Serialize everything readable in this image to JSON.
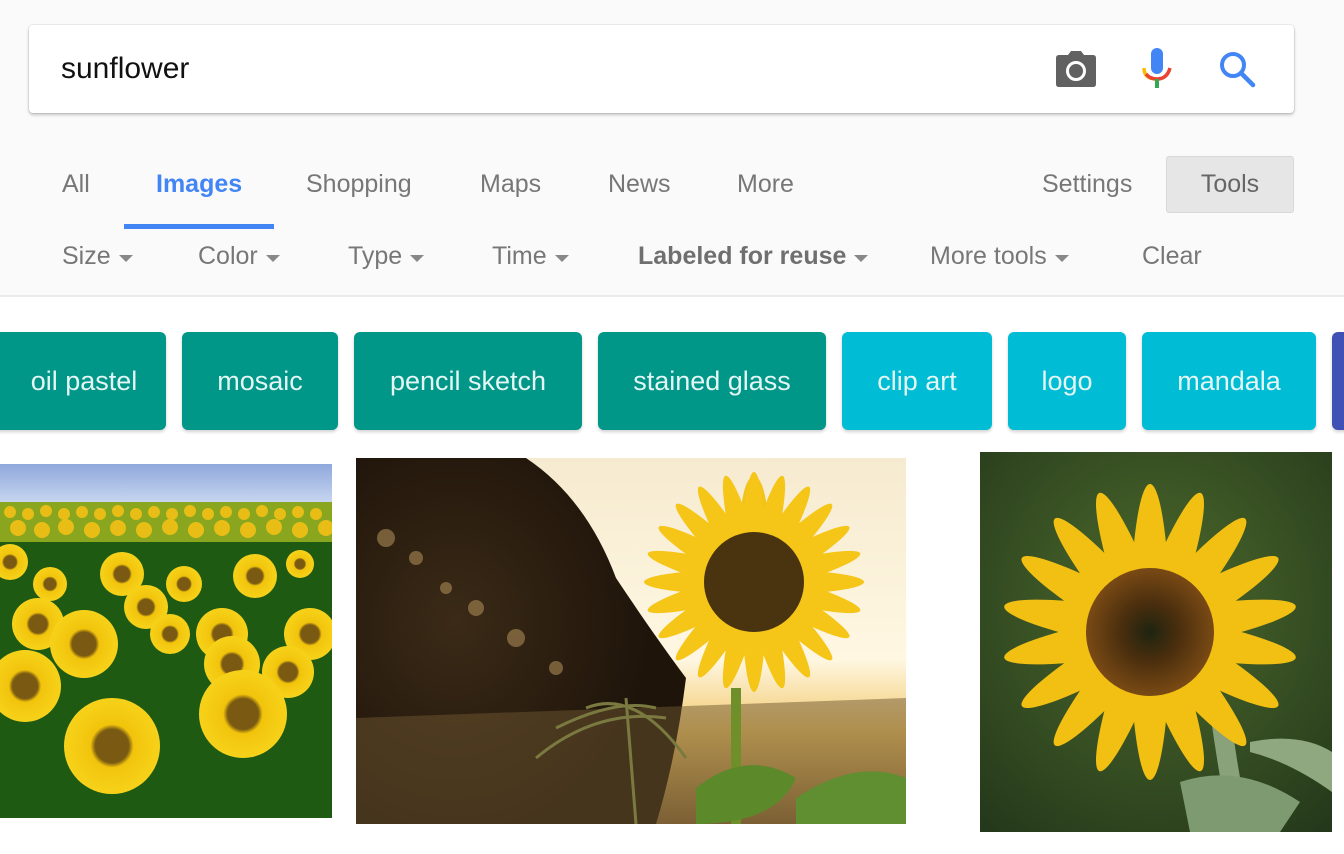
{
  "search": {
    "query": "sunflower",
    "icons": [
      "camera-icon",
      "microphone-icon",
      "search-icon"
    ]
  },
  "tabs": [
    {
      "label": "All",
      "active": false
    },
    {
      "label": "Images",
      "active": true
    },
    {
      "label": "Shopping",
      "active": false
    },
    {
      "label": "Maps",
      "active": false
    },
    {
      "label": "News",
      "active": false
    },
    {
      "label": "More",
      "active": false
    }
  ],
  "settings_label": "Settings",
  "tools_label": "Tools",
  "filters": [
    {
      "label": "Size"
    },
    {
      "label": "Color"
    },
    {
      "label": "Type"
    },
    {
      "label": "Time"
    },
    {
      "label": "Labeled for reuse",
      "selected": true
    },
    {
      "label": "More tools"
    }
  ],
  "clear_label": "Clear",
  "chips": [
    {
      "label": "oil pastel",
      "color": "#009688"
    },
    {
      "label": "mosaic",
      "color": "#009688"
    },
    {
      "label": "pencil sketch",
      "color": "#009688"
    },
    {
      "label": "stained glass",
      "color": "#009688"
    },
    {
      "label": "clip art",
      "color": "#00bcd4"
    },
    {
      "label": "logo",
      "color": "#00bcd4"
    },
    {
      "label": "mandala",
      "color": "#00bcd4"
    },
    {
      "label": "",
      "color": "#3f51b5"
    }
  ],
  "results": [
    {
      "description": "sunflower field under blue sky"
    },
    {
      "description": "sunflower at sunset with grass"
    },
    {
      "description": "single sunflower close-up"
    }
  ],
  "colors": {
    "accent": "#4285f4",
    "chip_teal": "#009688",
    "chip_cyan": "#00bcd4",
    "chip_indigo": "#3f51b5"
  }
}
